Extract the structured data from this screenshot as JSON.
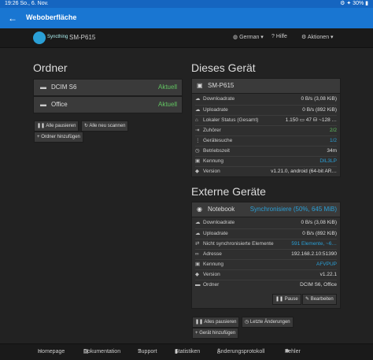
{
  "status_bar": {
    "time_date": "19:26  So., 6. Nov.",
    "right": "⚙ ✦ 30% ▮"
  },
  "app_bar": {
    "back_icon": "arrow-left-icon",
    "title": "Weboberfläche"
  },
  "navbar": {
    "logo_text": "Syncthing",
    "device_name": "SM-P615",
    "language": "German",
    "help": "Hilfe",
    "actions": "Aktionen"
  },
  "folders": {
    "title": "Ordner",
    "items": [
      {
        "name": "DCIM S6",
        "status": "Aktuell"
      },
      {
        "name": "Office",
        "status": "Aktuell"
      }
    ],
    "buttons": {
      "pause_all": "Alle pausieren",
      "rescan_all": "Alle neu scannen",
      "add_folder": "Ordner hinzufügen"
    }
  },
  "this_device": {
    "title": "Dieses Gerät",
    "name": "SM-P615",
    "rows": [
      {
        "label": "Downloadrate",
        "value": "0 B/s (3,08 KiB)"
      },
      {
        "label": "Uploadrate",
        "value": "0 B/s (892 KiB)"
      },
      {
        "label": "Lokaler Status (Gesamt)",
        "value": "1.150  ▭ 47  ⛁ ~128 …"
      },
      {
        "label": "Zuhörer",
        "value": "2/2"
      },
      {
        "label": "Gerätesuche",
        "value": "1/2"
      },
      {
        "label": "Betriebszeit",
        "value": "34m"
      },
      {
        "label": "Kennung",
        "value": "DIL3LP"
      },
      {
        "label": "Version",
        "value": "v1.21.0, android (64-bit AR…"
      }
    ]
  },
  "remote_devices": {
    "title": "Externe Geräte",
    "device": {
      "name": "Notebook",
      "status": "Synchronisiere (50%, 645 MiB)",
      "rows": [
        {
          "label": "Downloadrate",
          "value": "0 B/s (3,08 KiB)"
        },
        {
          "label": "Uploadrate",
          "value": "0 B/s (892 KiB)"
        },
        {
          "label": "Nicht synchronisierte Elemente",
          "value": "591 Elemente, ~6…"
        },
        {
          "label": "Adresse",
          "value": "192.168.2.10:51390"
        },
        {
          "label": "Kennung",
          "value": "AFVPUP"
        },
        {
          "label": "Version",
          "value": "v1.22.1"
        },
        {
          "label": "Ordner",
          "value": "DCIM S6, Office"
        }
      ],
      "buttons": {
        "pause": "Pause",
        "edit": "Bearbeiten"
      }
    },
    "buttons": {
      "pause_all": "Alles pausieren",
      "recent_changes": "Letzte Änderungen",
      "add_device": "Gerät hinzufügen"
    }
  },
  "footer": {
    "homepage": "Homepage",
    "docs": "Dokumentation",
    "support": "Support",
    "stats": "Statistiken",
    "changelog": "Änderungsprotokoll",
    "bugs": "Fehler"
  }
}
